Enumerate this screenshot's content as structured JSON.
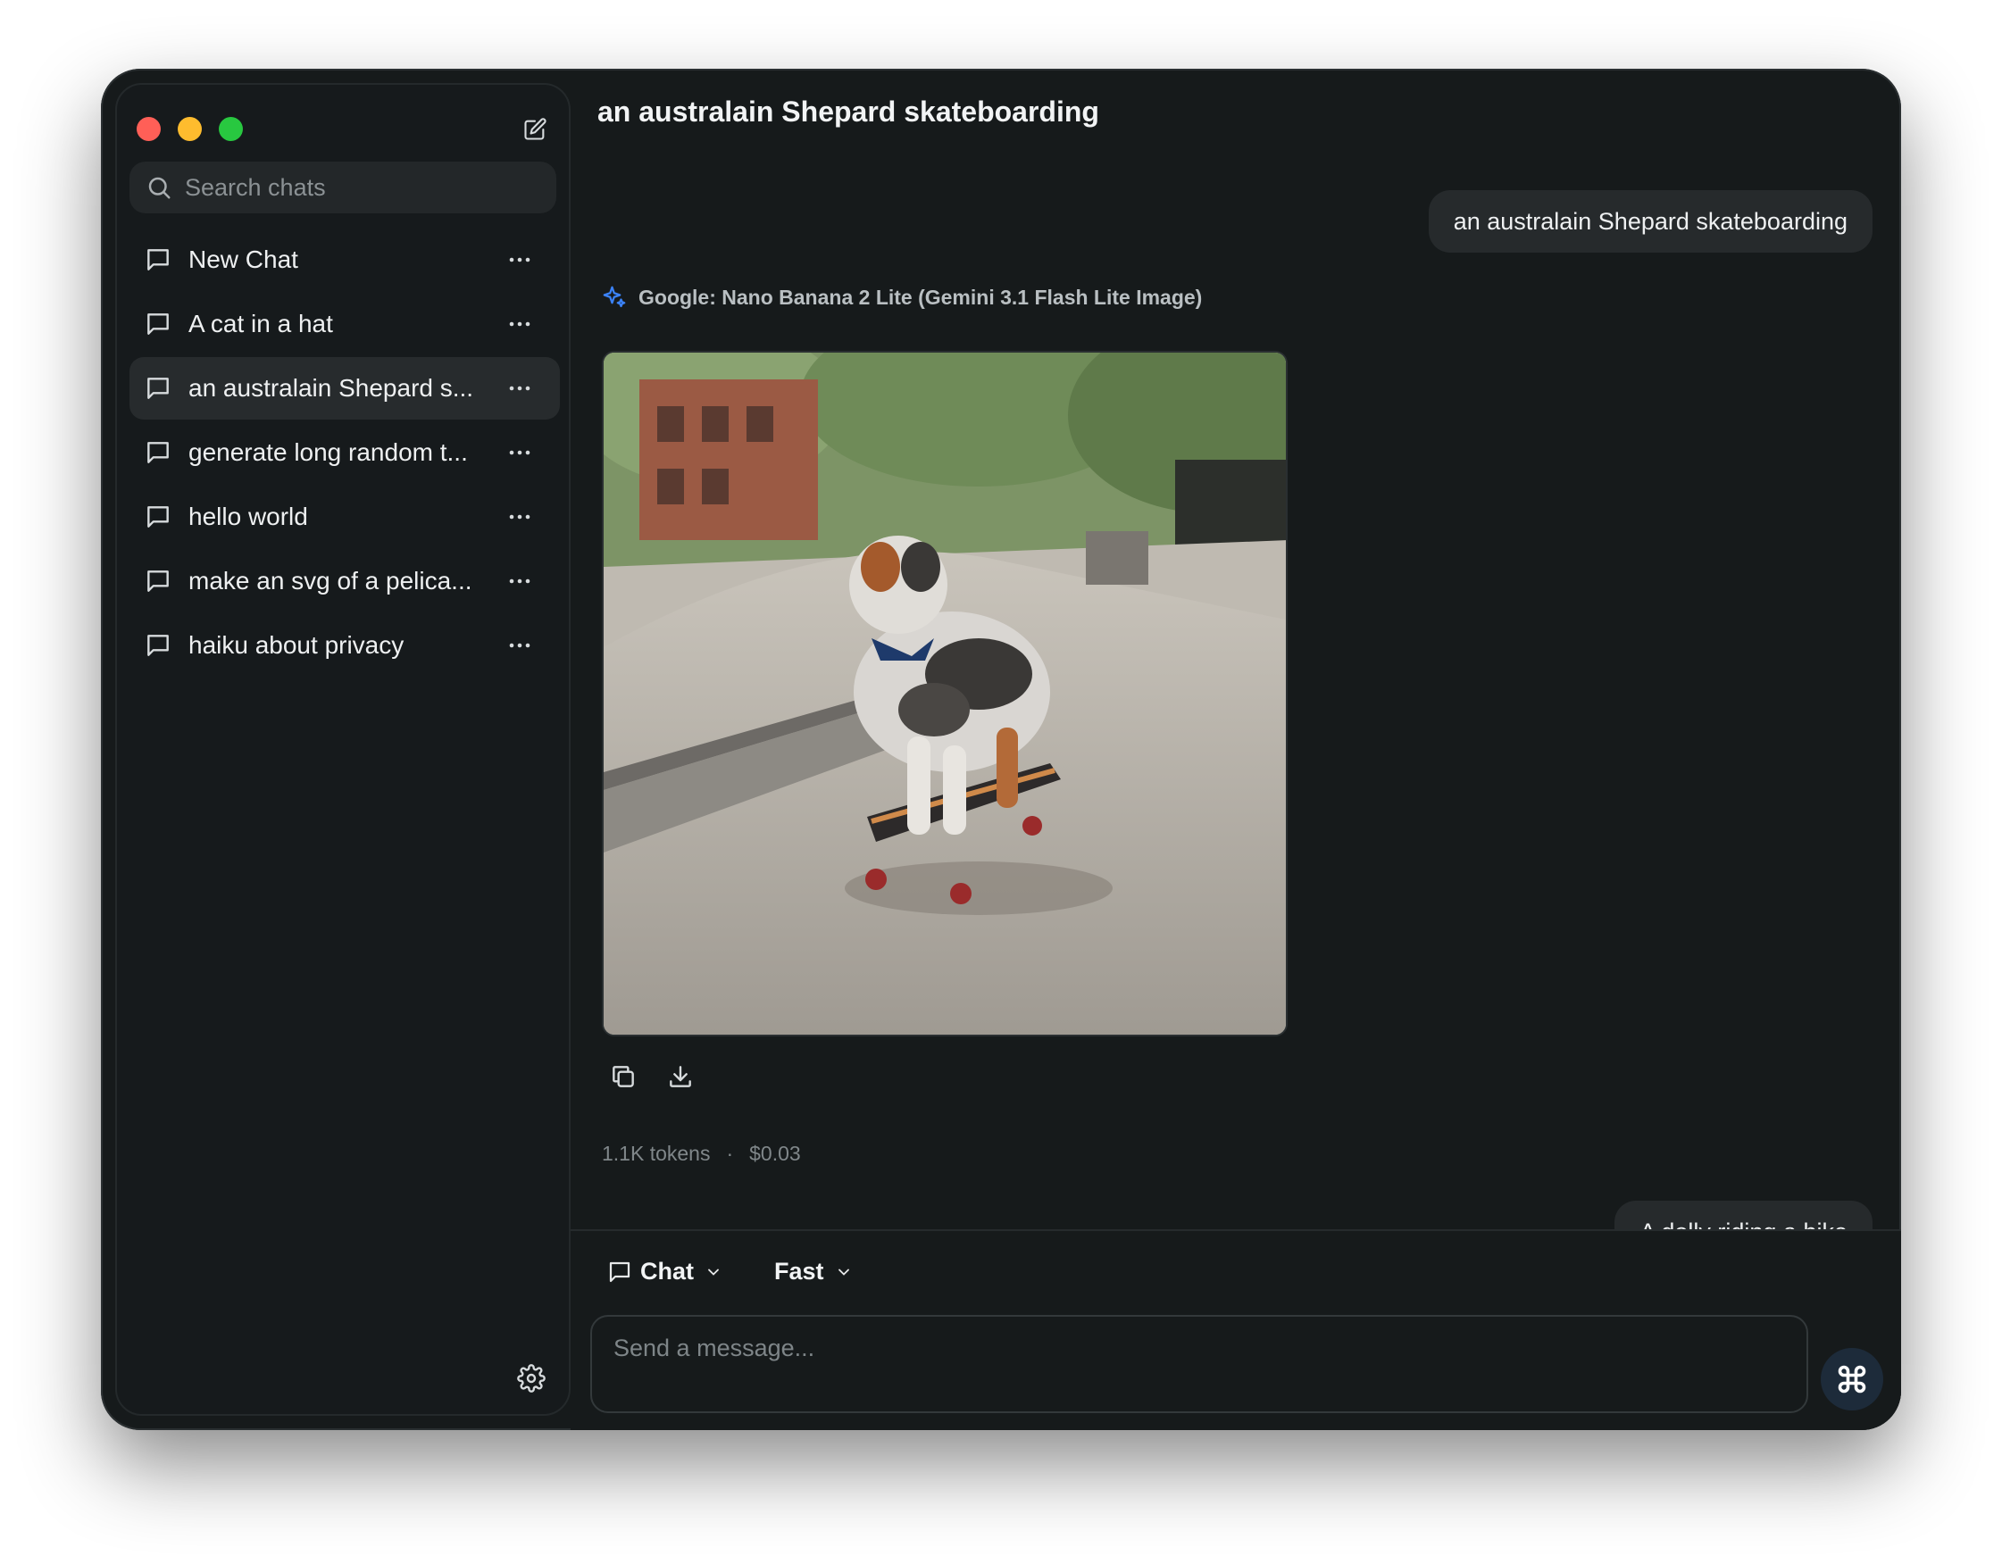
{
  "window": {
    "title": "an australain Shepard skateboarding"
  },
  "sidebar": {
    "search": {
      "placeholder": "Search chats",
      "value": ""
    },
    "items": [
      {
        "label": "New Chat",
        "active": false
      },
      {
        "label": "A cat in a hat",
        "active": false
      },
      {
        "label": "an australain Shepard s...",
        "active": true
      },
      {
        "label": "generate long random t...",
        "active": false
      },
      {
        "label": "hello world",
        "active": false
      },
      {
        "label": "make an svg of a pelica...",
        "active": false
      },
      {
        "label": "haiku about privacy",
        "active": false
      }
    ]
  },
  "conversation": {
    "user_message": "an australain Shepard skateboarding",
    "model_name": "Google: Nano Banana 2 Lite (Gemini 3.1 Flash Lite Image)",
    "usage": {
      "tokens": "1.1K tokens",
      "separator": "·",
      "cost": "$0.03"
    },
    "next_user_message": "A dolly riding a bike"
  },
  "composer": {
    "mode_label": "Chat",
    "speed_label": "Fast",
    "placeholder": "Send a message..."
  },
  "colors": {
    "accent": "#3b82f6",
    "window_bg": "#161a1b",
    "bubble_bg": "#262a2c"
  }
}
